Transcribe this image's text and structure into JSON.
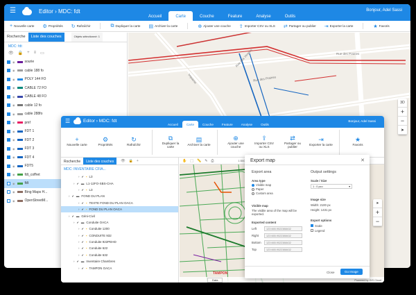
{
  "colors": {
    "accent": "#1e88e5",
    "selected_row": "#bbdefb"
  },
  "back": {
    "app": "Editor",
    "map_name": "MDC: fdt",
    "tabs": [
      "Accueil",
      "Carte",
      "Couche",
      "Feature",
      "Analyse",
      "Outils"
    ],
    "active_tab": "Carte",
    "greeting": "Bonjour, Adel Sassi",
    "toolbar": [
      {
        "label": "Nouvelle carte",
        "icon": "plus-icon"
      },
      {
        "label": "Propriétés",
        "icon": "gear-icon"
      },
      {
        "label": "Rafraîchir",
        "icon": "refresh-icon"
      },
      {
        "label": "Dupliquer la carte",
        "icon": "duplicate-icon"
      },
      {
        "label": "Archiver la carte",
        "icon": "archive-icon"
      },
      {
        "label": "Ajouter une couche",
        "icon": "add-layer-icon"
      },
      {
        "label": "Importer CSV ou XLS",
        "icon": "import-icon"
      },
      {
        "label": "Partager ou publier",
        "icon": "share-icon"
      },
      {
        "label": "Exporter la carte",
        "icon": "export-icon"
      },
      {
        "label": "Favoris",
        "icon": "star-icon"
      }
    ],
    "panel_tabs": [
      "Rocherche",
      "Liste des couches"
    ],
    "selected_objects": "Objets sélectionné: 1",
    "map_title": "MDC: fdt",
    "layers": [
      "sourie",
      "cable 188 fo",
      "POLY 144 FO",
      "CABLE 72 FO",
      "CABLE 48 FO",
      "cable 12 fo",
      "cable 288fo",
      "pmf",
      "FDT 1",
      "FDT 2",
      "FDT 3",
      "FDT 4",
      "FDT5",
      "fdt_coffret",
      "fdt",
      "Bing Maps H...",
      "OpenStreetM..."
    ],
    "selected_layer": "fdt",
    "streets": [
      "Rue des Vergers",
      "Rue des Prairies",
      "Rue des Prairies",
      "Impasse"
    ],
    "map_button": "3D"
  },
  "front": {
    "app": "Editor",
    "map_name": "MDC: fdt",
    "tabs": [
      "Accueil",
      "Carte",
      "Couche",
      "Feature",
      "Analyse",
      "Outils"
    ],
    "active_tab": "Carte",
    "greeting": "Bonjour, Adel Sassi",
    "toolbar": [
      {
        "label": "Nouvelle carte",
        "icon": "plus-icon"
      },
      {
        "label": "Propriétés",
        "icon": "gear-icon"
      },
      {
        "label": "Rafraîchir",
        "icon": "refresh-icon"
      },
      {
        "label": "Dupliquer la carte",
        "icon": "duplicate-icon"
      },
      {
        "label": "Archiver la carte",
        "icon": "archive-icon"
      },
      {
        "label": "Ajouter une couche",
        "icon": "add-layer-icon"
      },
      {
        "label": "Importer CSV ou XLS",
        "icon": "import-icon"
      },
      {
        "label": "Partager ou publier",
        "icon": "share-icon"
      },
      {
        "label": "Exporter la carte",
        "icon": "export-icon"
      },
      {
        "label": "Favoris",
        "icon": "star-icon"
      }
    ],
    "panel_tabs": [
      "Rocherche",
      "Liste des couches"
    ],
    "zoom_value": "1:5000",
    "coordinates": "4908711.4971 - 8071072",
    "map_title": "MDC: INVENTAIRE CFIA...",
    "layers": [
      "L3",
      "L1-12FO-SBS-CHA",
      "L3",
      "FOND DU PLAN",
      "TEXTE FOND DU PLAN OACA",
      "FOND DU PLAN OACA",
      "Géni-Civil",
      "Conduite OACA",
      "Conduite 1200",
      "CONDUITE 932",
      "Conduite 922PEHD",
      "Conduite 622",
      "Conduite 632",
      "Inventaire Chambres",
      "TAMPON OACA"
    ],
    "selected_layer": "FOND DU PLAN OACA",
    "bottom_value": "Data",
    "powered": "Powered by GIS Cloud",
    "map_label": "TAMPON"
  },
  "export_dialog": {
    "title": "Export map",
    "export_area": "Export area",
    "area_type": "Area type",
    "area_options": [
      "Visible map",
      "Paper",
      "Custom area"
    ],
    "area_selected": "Visible map",
    "visible_map": "Visible map",
    "visible_note": "The visible area of the map will be exported.",
    "extent": "Exported content",
    "extent_labels": [
      "Left",
      "Right",
      "Bottom",
      "Top"
    ],
    "extent_values": [
      "123 665.9022388432",
      "123 665.9022388432",
      "123 665.9022388432",
      "123 665.9022388432"
    ],
    "output_settings": "Output settings",
    "scale_size": "Scale / Size",
    "scale_value": "1 : 0 pco",
    "image_size": "Image size",
    "width": "Width: 2100 px",
    "height": "Height: 1431 px",
    "export_options": "Export options",
    "opt_scale": "Scale",
    "opt_legend": "Legend",
    "cancel": "Close",
    "export": "Go Image"
  }
}
